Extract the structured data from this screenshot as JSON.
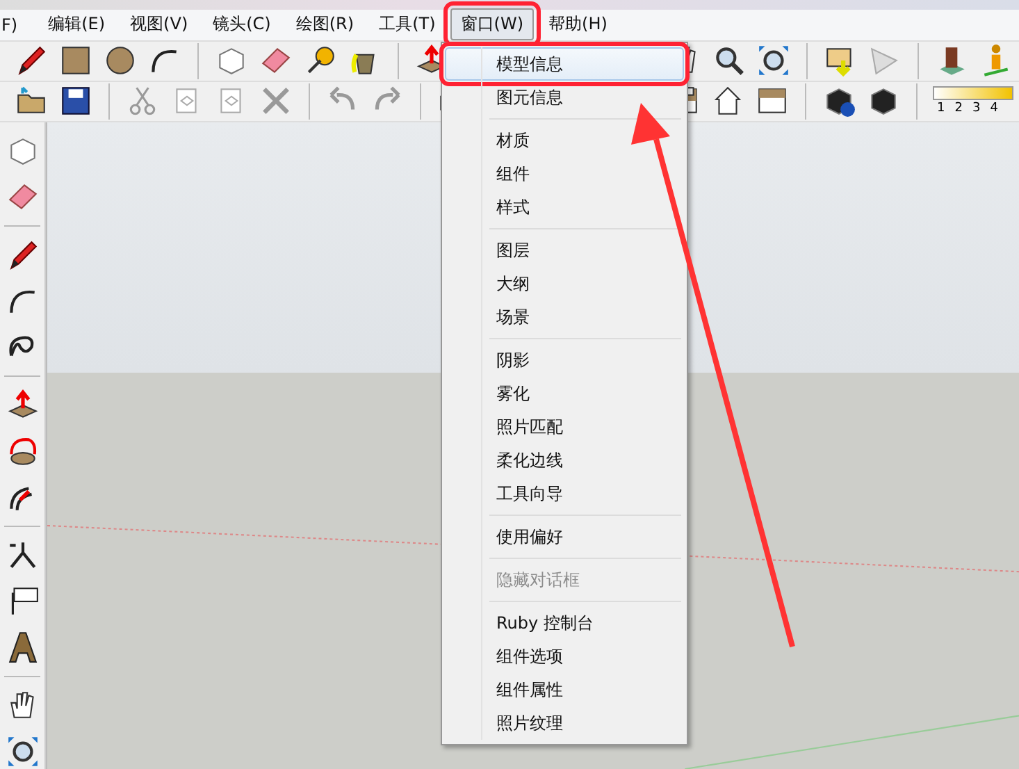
{
  "menu_bar": [
    {
      "label": "F)",
      "selected": false
    },
    {
      "label": "编辑(E)",
      "selected": false
    },
    {
      "label": "视图(V)",
      "selected": false
    },
    {
      "label": "镜头(C)",
      "selected": false
    },
    {
      "label": "绘图(R)",
      "selected": false
    },
    {
      "label": "工具(T)",
      "selected": false
    },
    {
      "label": "窗口(W)",
      "selected": true
    },
    {
      "label": "帮助(H)",
      "selected": false
    }
  ],
  "dropdown": {
    "sections": [
      {
        "items": [
          {
            "label": "模型信息",
            "highlighted": true,
            "disabled": false
          },
          {
            "label": "图元信息",
            "highlighted": false,
            "disabled": false
          }
        ]
      },
      {
        "items": [
          {
            "label": "材质",
            "highlighted": false,
            "disabled": false
          },
          {
            "label": "组件",
            "highlighted": false,
            "disabled": false
          },
          {
            "label": "样式",
            "highlighted": false,
            "disabled": false
          }
        ]
      },
      {
        "items": [
          {
            "label": "图层",
            "highlighted": false,
            "disabled": false
          },
          {
            "label": "大纲",
            "highlighted": false,
            "disabled": false
          },
          {
            "label": "场景",
            "highlighted": false,
            "disabled": false
          }
        ]
      },
      {
        "items": [
          {
            "label": "阴影",
            "highlighted": false,
            "disabled": false
          },
          {
            "label": "雾化",
            "highlighted": false,
            "disabled": false
          },
          {
            "label": "照片匹配",
            "highlighted": false,
            "disabled": false
          },
          {
            "label": "柔化边线",
            "highlighted": false,
            "disabled": false
          },
          {
            "label": "工具向导",
            "highlighted": false,
            "disabled": false
          }
        ]
      },
      {
        "items": [
          {
            "label": "使用偏好",
            "highlighted": false,
            "disabled": false
          }
        ]
      },
      {
        "items": [
          {
            "label": "隐藏对话框",
            "highlighted": false,
            "disabled": true
          }
        ]
      },
      {
        "items": [
          {
            "label": "Ruby 控制台",
            "highlighted": false,
            "disabled": false
          },
          {
            "label": "组件选项",
            "highlighted": false,
            "disabled": false
          },
          {
            "label": "组件属性",
            "highlighted": false,
            "disabled": false
          },
          {
            "label": "照片纹理",
            "highlighted": false,
            "disabled": false
          }
        ]
      }
    ]
  },
  "scale_labels": [
    "1",
    "2",
    "3",
    "4"
  ]
}
